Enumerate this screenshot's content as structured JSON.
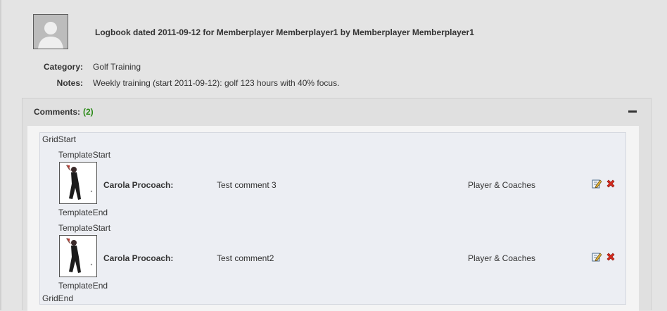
{
  "logbook": {
    "title": "Logbook dated 2011-09-12 for Memberplayer Memberplayer1 by Memberplayer Memberplayer1",
    "category_label": "Category:",
    "category_value": "Golf Training",
    "notes_label": "Notes:",
    "notes_value": "Weekly training (start 2011-09-12): golf 123 hours with 40% focus."
  },
  "comments": {
    "header_label": "Comments:",
    "count": "(2)",
    "grid_start": "GridStart",
    "grid_end": "GridEnd",
    "items": [
      {
        "template_start": "TemplateStart",
        "author": "Carola Procoach:",
        "text": "Test comment 3",
        "visibility": "Player & Coaches",
        "template_end": "TemplateEnd"
      },
      {
        "template_start": "TemplateStart",
        "author": "Carola Procoach:",
        "text": "Test comment2",
        "visibility": "Player & Coaches",
        "template_end": "TemplateEnd"
      }
    ]
  },
  "icons": {
    "avatar": "user-silhouette-icon",
    "collapse": "minus-icon",
    "edit": "edit-pencil-icon",
    "delete": "red-x-icon"
  },
  "colors": {
    "count_green": "#2a8a16",
    "delete_red": "#d62b1f"
  }
}
